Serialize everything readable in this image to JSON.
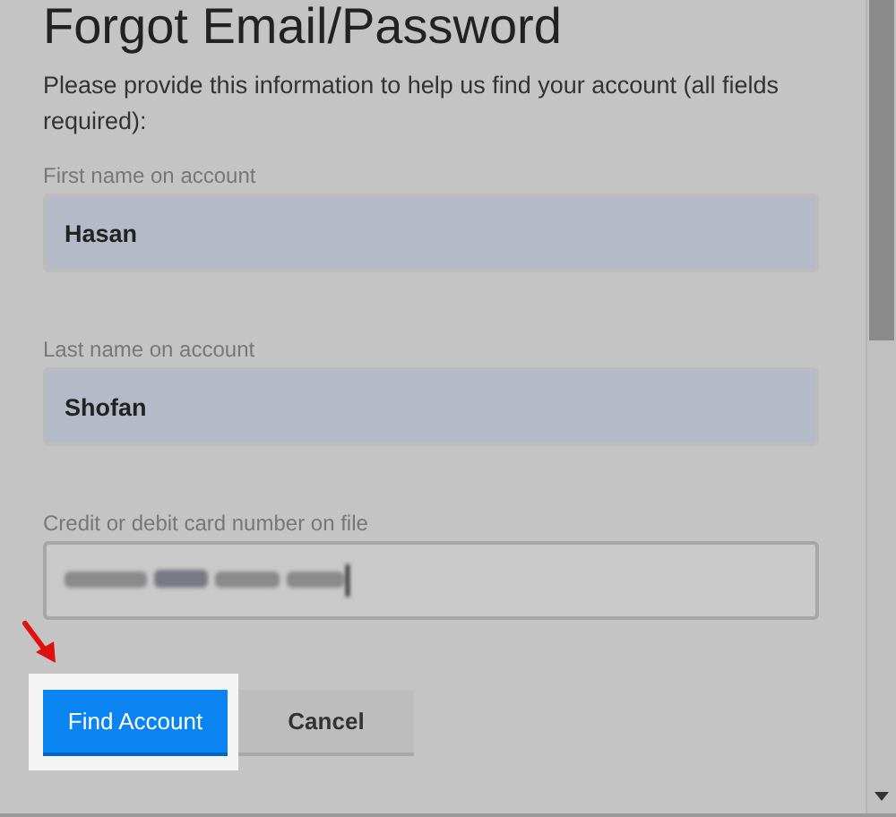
{
  "dialog": {
    "title": "Forgot Email/Password",
    "instructions": "Please provide this information to help us find your account (all fields required):",
    "fields": [
      {
        "label": "First name on account",
        "value": "Hasan",
        "autofilled": true,
        "redacted": false
      },
      {
        "label": "Last name on account",
        "value": "Shofan",
        "autofilled": true,
        "redacted": false
      },
      {
        "label": "Credit or debit card number on file",
        "autofilled": false,
        "redacted": true
      }
    ],
    "buttons": [
      {
        "label": "Find Account",
        "kind": "primary",
        "highlighted": true
      },
      {
        "label": "Cancel",
        "kind": "secondary",
        "highlighted": false
      }
    ]
  }
}
